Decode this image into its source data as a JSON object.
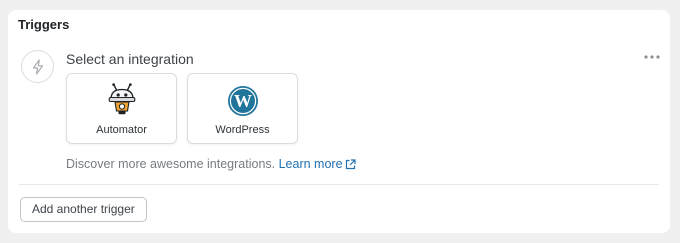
{
  "card": {
    "title": "Triggers"
  },
  "step": {
    "icon": "bolt-icon",
    "title": "Select an integration",
    "more_icon": "more-horizontal-icon"
  },
  "integrations": [
    {
      "label": "Automator",
      "icon": "automator-robot-icon"
    },
    {
      "label": "WordPress",
      "icon": "wordpress-logo-icon"
    }
  ],
  "discover": {
    "text": "Discover more awesome integrations.",
    "link_label": "Learn more",
    "link_icon": "external-link-icon"
  },
  "footer": {
    "add_trigger_label": "Add another trigger"
  },
  "colors": {
    "link": "#2271b1",
    "wordpress_blue": "#21759b",
    "robot_orange": "#f0a330"
  }
}
